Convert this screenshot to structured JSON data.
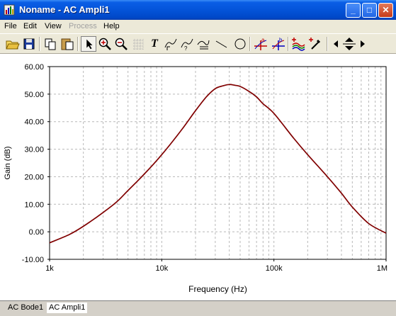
{
  "window": {
    "title": "Noname - AC Ampli1",
    "buttons": {
      "minimize": "_",
      "maximize": "□",
      "close": "✕"
    }
  },
  "menu": [
    {
      "label": "File",
      "enabled": true
    },
    {
      "label": "Edit",
      "enabled": true
    },
    {
      "label": "View",
      "enabled": true
    },
    {
      "label": "Process",
      "enabled": false
    },
    {
      "label": "Help",
      "enabled": true
    }
  ],
  "toolbar": {
    "icons": [
      "open-folder-icon",
      "save-disk-icon",
      "copy-icon",
      "paste-icon",
      "select-arrow-icon",
      "zoom-in-icon",
      "zoom-out-icon",
      "grid-icon",
      "text-icon",
      "cursor-a-icon",
      "cursor-b-icon",
      "curve-label-icon",
      "line-icon",
      "circle-icon",
      "marker-a-icon",
      "marker-b-icon",
      "add-curves-icon",
      "pick-color-icon",
      "arrow-left-icon",
      "arrow-updown-icon",
      "arrow-right-icon"
    ],
    "text_tool_label": "T",
    "marker_a_label": "a",
    "marker_b_label": "b"
  },
  "tabs": [
    {
      "label": "AC Bode1",
      "active": false
    },
    {
      "label": "AC Ampli1",
      "active": true
    }
  ],
  "chart_data": {
    "type": "line",
    "xlabel": "Frequency (Hz)",
    "ylabel": "Gain (dB)",
    "xscale": "log",
    "xlim": [
      1000,
      1000000
    ],
    "ylim": [
      -10,
      60
    ],
    "x_ticks": [
      "1k",
      "10k",
      "100k",
      "1M"
    ],
    "y_ticks": [
      "-10.00",
      "0.00",
      "10.00",
      "20.00",
      "30.00",
      "40.00",
      "50.00",
      "60.00"
    ],
    "grid": true,
    "line_color": "#800000",
    "series": [
      {
        "x": [
          1000,
          1500,
          2000,
          3000,
          4000,
          5000,
          7000,
          10000,
          15000,
          20000,
          25000,
          30000,
          35000,
          40000,
          45000,
          50000,
          60000,
          70000,
          80000,
          100000,
          150000,
          200000,
          300000,
          400000,
          500000,
          700000,
          1000000
        ],
        "values": [
          -4,
          -1,
          2,
          7,
          11,
          15,
          21,
          28,
          37,
          44,
          49,
          52,
          53,
          53.5,
          53.2,
          52.8,
          51,
          49,
          46.5,
          43,
          34,
          28,
          20,
          14,
          9,
          3,
          -0.5
        ]
      }
    ]
  }
}
